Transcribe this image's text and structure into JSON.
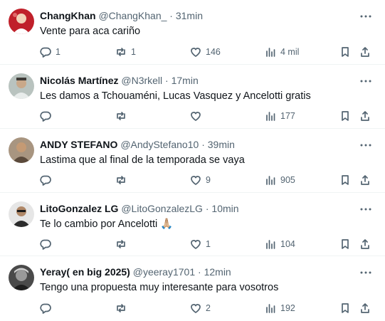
{
  "replies": [
    {
      "name": "ChangKhan",
      "handle": "@ChangKhan_",
      "separator": "·",
      "time": "31min",
      "text": "Vente para aca cariño",
      "replies": "1",
      "reposts": "1",
      "likes": "146",
      "views": "4 mil",
      "avatar_color": "#c0202a"
    },
    {
      "name": "Nicolás Martínez",
      "handle": "@N3rkell",
      "separator": "·",
      "time": "17min",
      "text": "Les damos a Tchouaméni, Lucas Vasquez y Ancelotti gratis",
      "replies": "",
      "reposts": "",
      "likes": "",
      "views": "177",
      "avatar_color": "#9aa3a0"
    },
    {
      "name": "ANDY STEFANO",
      "handle": "@AndyStefano10",
      "separator": "·",
      "time": "39min",
      "text": "Lastima que al final de la temporada se vaya",
      "replies": "",
      "reposts": "",
      "likes": "9",
      "views": "905",
      "avatar_color": "#8a7560"
    },
    {
      "name": "LitoGonzalez LG",
      "handle": "@LitoGonzalezLG",
      "separator": "·",
      "time": "10min",
      "text": "Te lo cambio por Ancelotti 🙏🏼",
      "replies": "",
      "reposts": "",
      "likes": "1",
      "views": "104",
      "avatar_color": "#d9d9d9"
    },
    {
      "name": "Yeray( en big 2025)",
      "handle": "@yeeray1701",
      "separator": "·",
      "time": "12min",
      "text": "Tengo una propuesta muy interesante para vosotros",
      "replies": "",
      "reposts": "",
      "likes": "2",
      "views": "192",
      "avatar_color": "#3a3a3a"
    }
  ],
  "icons": {
    "more": "more-horizontal-icon",
    "reply": "reply-bubble-icon",
    "repost": "repost-arrows-icon",
    "like": "heart-icon",
    "views": "views-bar-chart-icon",
    "bookmark": "bookmark-icon",
    "share": "share-upload-icon"
  },
  "colors": {
    "text": "#0f1419",
    "secondary": "#536471",
    "divider": "#eff3f4"
  }
}
